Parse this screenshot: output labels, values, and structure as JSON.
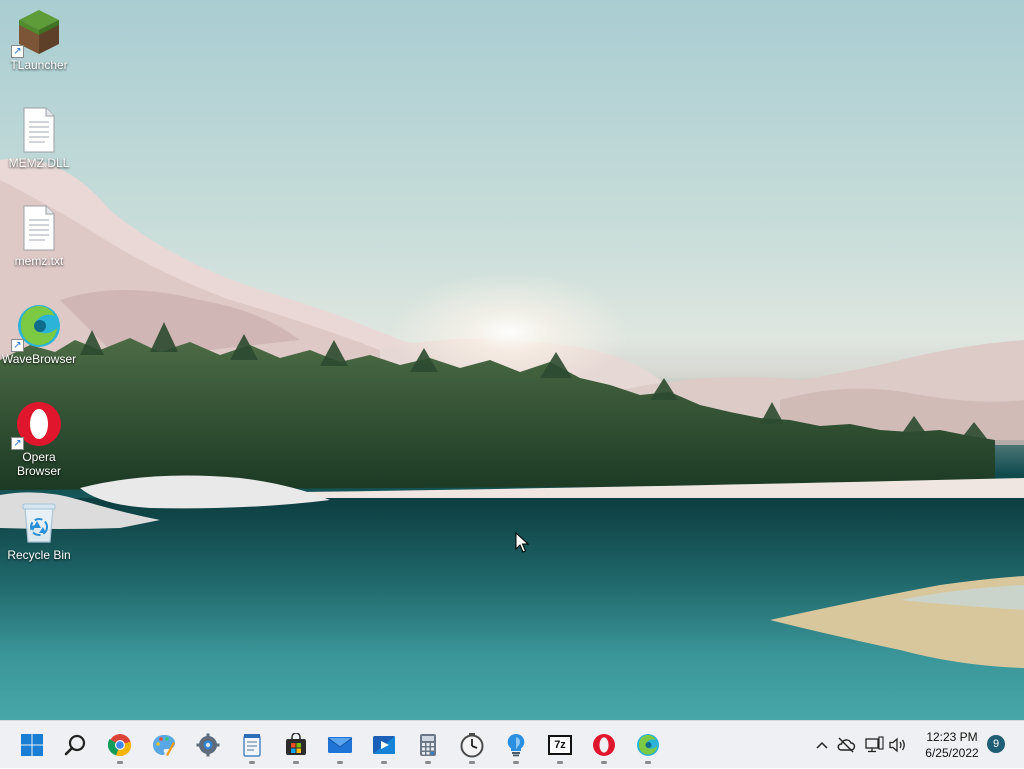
{
  "desktop_icons": [
    {
      "name": "icon-tlauncher",
      "label": "TLauncher",
      "icon": "minecraft-grass-block-icon",
      "shortcut": true
    },
    {
      "name": "icon-memz-dll",
      "label": "MEMZ.DLL",
      "icon": "document-file-icon",
      "shortcut": false
    },
    {
      "name": "icon-memz-txt",
      "label": "memz.txt",
      "icon": "text-file-icon",
      "shortcut": false
    },
    {
      "name": "icon-wavebrowser",
      "label": "WaveBrowser",
      "icon": "wavebrowser-icon",
      "shortcut": true
    },
    {
      "name": "icon-opera",
      "label": "Opera Browser",
      "icon": "opera-icon",
      "shortcut": true
    },
    {
      "name": "icon-recycle-bin",
      "label": "Recycle Bin",
      "icon": "recycle-bin-icon",
      "shortcut": false
    }
  ],
  "taskbar": {
    "apps": [
      {
        "name": "start-button",
        "icon": "windows-start-icon",
        "running": false
      },
      {
        "name": "search-button",
        "icon": "search-icon",
        "running": false
      },
      {
        "name": "chrome-button",
        "icon": "chrome-icon",
        "running": true
      },
      {
        "name": "paint-button",
        "icon": "paint-icon",
        "running": false
      },
      {
        "name": "settings-button",
        "icon": "settings-gear-icon",
        "running": false
      },
      {
        "name": "notepad-button",
        "icon": "notepad-icon",
        "running": true
      },
      {
        "name": "store-button",
        "icon": "microsoft-store-icon",
        "running": true
      },
      {
        "name": "mail-button",
        "icon": "mail-icon",
        "running": true
      },
      {
        "name": "media-player-button",
        "icon": "media-player-icon",
        "running": true
      },
      {
        "name": "calculator-button",
        "icon": "calculator-icon",
        "running": true
      },
      {
        "name": "clock-button",
        "icon": "clock-icon",
        "running": true
      },
      {
        "name": "tips-button",
        "icon": "tips-lightbulb-icon",
        "running": true
      },
      {
        "name": "7zip-button",
        "icon": "7zip-icon",
        "running": true
      },
      {
        "name": "opera-button",
        "icon": "opera-icon",
        "running": true
      },
      {
        "name": "wavebrowser-button",
        "icon": "wavebrowser-icon",
        "running": true
      }
    ],
    "seven_zip_label": "7z",
    "tray_icons": [
      "chevron-up-icon",
      "cloud-offline-icon",
      "network-icon",
      "volume-icon"
    ],
    "time": "12:23 PM",
    "date": "6/25/2022",
    "notification_count": "9"
  },
  "colors": {
    "taskbar_bg": "#eef0f3",
    "windows_blue": "#1a7fd4",
    "opera_red": "#e0172c",
    "notification_badge": "#1f5e74"
  }
}
